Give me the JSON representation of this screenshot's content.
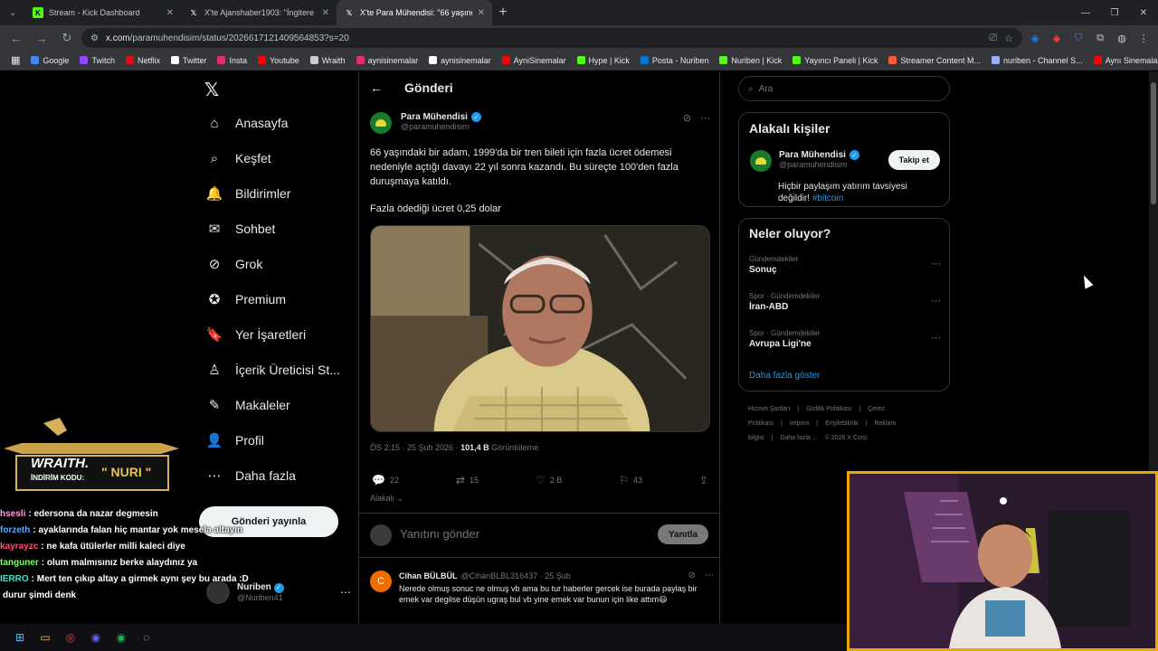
{
  "tabs": [
    {
      "title": "Stream - Kick Dashboard",
      "icon": "kick-icon",
      "color": "#53fc18",
      "active": false
    },
    {
      "title": "X'te Ajanshaber1903: \"İngitere",
      "icon": "x-icon",
      "color": "#ffffff",
      "active": false
    },
    {
      "title": "X'te Para Mühendisi: \"66 yaşınd",
      "icon": "x-icon",
      "color": "#ffffff",
      "active": true
    }
  ],
  "address": {
    "host": "x.com",
    "path": "/paramuhendisim/status/2026617121409564853?s=20"
  },
  "bookmarks": [
    {
      "label": "Google",
      "color": "#4285f4"
    },
    {
      "label": "Twitch",
      "color": "#9146ff"
    },
    {
      "label": "Netflix",
      "color": "#e50914"
    },
    {
      "label": "Twitter",
      "color": "#ffffff"
    },
    {
      "label": "Insta",
      "color": "#e1306c"
    },
    {
      "label": "Youtube",
      "color": "#ff0000"
    },
    {
      "label": "Wraith",
      "color": "#cccccc"
    },
    {
      "label": "aynisinemalar",
      "color": "#e1306c"
    },
    {
      "label": "aynisinemalar",
      "color": "#ffffff"
    },
    {
      "label": "AyniSinemalar",
      "color": "#ff0000"
    },
    {
      "label": "Hype | Kick",
      "color": "#53fc18"
    },
    {
      "label": "Posta - Nuriben",
      "color": "#0078d4"
    },
    {
      "label": "Nuriben | Kick",
      "color": "#53fc18"
    },
    {
      "label": "Yayıncı Paneli | Kick",
      "color": "#53fc18"
    },
    {
      "label": "Streamer Content M...",
      "color": "#ff5a36"
    },
    {
      "label": "nuriben - Channel S...",
      "color": "#9ab0ff"
    },
    {
      "label": "Aynı Sinemalar - Ça...",
      "color": "#ff0000"
    }
  ],
  "sidenav": {
    "items": [
      {
        "label": "Anasayfa",
        "icon": "home-icon",
        "glyph": "⌂"
      },
      {
        "label": "Keşfet",
        "icon": "search-icon",
        "glyph": "⌕"
      },
      {
        "label": "Bildirimler",
        "icon": "bell-icon",
        "glyph": "🔔"
      },
      {
        "label": "Sohbet",
        "icon": "mail-icon",
        "glyph": "✉"
      },
      {
        "label": "Grok",
        "icon": "grok-icon",
        "glyph": "⊘"
      },
      {
        "label": "Premium",
        "icon": "premium-icon",
        "glyph": "✪"
      },
      {
        "label": "Yer İşaretleri",
        "icon": "bookmark-icon",
        "glyph": "🔖"
      },
      {
        "label": "İçerik Üreticisi St...",
        "icon": "creator-icon",
        "glyph": "♙"
      },
      {
        "label": "Makaleler",
        "icon": "articles-icon",
        "glyph": "✎"
      },
      {
        "label": "Profil",
        "icon": "profile-icon",
        "glyph": "👤"
      },
      {
        "label": "Daha fazla",
        "icon": "more-icon",
        "glyph": "⋯"
      }
    ],
    "post_button": "Gönderi yayınla",
    "account": {
      "name": "Nuriben",
      "handle": "@Nuriben41"
    }
  },
  "main": {
    "header": "Gönderi",
    "author": {
      "name": "Para Mühendisi",
      "handle": "@paramuhendisim"
    },
    "text": "66 yaşındaki bir adam, 1999'da bir tren bileti için fazla ücret ödemesi nedeniyle açtığı davayı 22 yıl sonra kazandı. Bu süreçte 100'den fazla duruşmaya katıldı.",
    "text2": "Fazla ödediği ücret  0,25 dolar",
    "meta": {
      "time": "ÖS 2:15 · 25 Şub 2026 · ",
      "views": "101,4 B",
      "views_label": " Görüntüleme"
    },
    "actions": {
      "replies": "22",
      "reposts": "15",
      "likes": "2 B",
      "bookmarks": "43"
    },
    "relevance": "Alakalı",
    "reply_placeholder": "Yanıtını gönder",
    "reply_button": "Yanıtla",
    "comment": {
      "initial": "C",
      "name": "Cihan BÜLBÜL",
      "handle": "@CihanBLBL316437 · 25 Şub",
      "text": "Nerede olmuş sonuc ne olmuş vb ama bu tur haberler gercek ise burada paylaş bir emek var degilse düşün ugraş bul vb yine emek var bunun için like attım😃"
    }
  },
  "right": {
    "search_placeholder": "Ara",
    "related_title": "Alakalı kişiler",
    "related": {
      "name": "Para Mühendisi",
      "handle": "@paramuhendisim",
      "follow": "Takip et",
      "bio": "Hiçbir paylaşım yatırım tavsiyesi değildir! ",
      "tag": "#bitcoin"
    },
    "trends_title": "Neler oluyor?",
    "trends": [
      {
        "category": "Gündemdekiler",
        "name": "Sonuç"
      },
      {
        "category": "Spor · Gündemdekiler",
        "name": "İran-ABD"
      },
      {
        "category": "Spor · Gündemdekiler",
        "name": "Avrupa Ligi'ne"
      }
    ],
    "show_more": "Daha fazla göster",
    "footer": [
      "Hizmet Şartları",
      "|",
      "Gizlilik Politikası",
      "|",
      "Çerez Politikası",
      "|",
      "Imprint",
      "|",
      "Erişilebilirlik",
      "|",
      "Reklam bilgisi",
      "|",
      "Daha fazla ...",
      "© 2026 X Corp."
    ]
  },
  "overlay": {
    "sponsor_brand": "WRAITH.",
    "sponsor_code_label": "İNDİRİM KODU:",
    "sponsor_code": "\" NURI \"",
    "chat": [
      {
        "user": "hsesli",
        "color": "#ff9ee0",
        "msg": ": edersona da nazar degmesin"
      },
      {
        "user": "forzeth",
        "color": "#5aa8ff",
        "msg": ": ayaklarında falan hiç mantar yok mesela altayın"
      },
      {
        "user": "kayrayzc",
        "color": "#ff4d6d",
        "msg": ": ne kafa ütülerler milli kaleci diye"
      },
      {
        "user": "tanguner",
        "color": "#7dff6a",
        "msg": ": olum malmısınız berke alaydınız ya"
      },
      {
        "user": "IERRO",
        "color": "#43e0c8",
        "msg": ": Mert ten çıkıp altay a girmek aynı şey bu arada :D"
      },
      {
        "user": "",
        "color": "#ffffff",
        "msg": "durur şimdi denk"
      }
    ]
  }
}
